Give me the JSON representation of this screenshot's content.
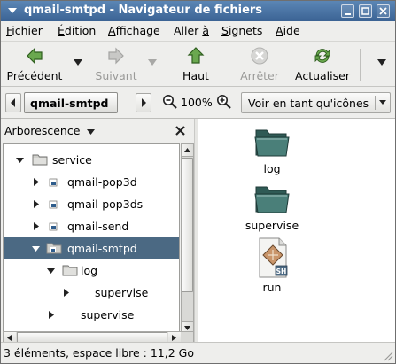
{
  "window": {
    "title": "qmail-smtpd - Navigateur de fichiers"
  },
  "menubar": {
    "items": [
      {
        "hotkey": "F",
        "rest": "ichier"
      },
      {
        "hotkey": "É",
        "rest": "dition"
      },
      {
        "hotkey": "A",
        "rest": "ffichage"
      },
      {
        "prefix": "Aller ",
        "hotkey": "à",
        "rest": ""
      },
      {
        "hotkey": "S",
        "rest": "ignets"
      },
      {
        "hotkey": "A",
        "rest": "ide"
      }
    ]
  },
  "toolbar": {
    "back_label": "Précédent",
    "forward_label": "Suivant",
    "up_label": "Haut",
    "stop_label": "Arrêter",
    "reload_label": "Actualiser"
  },
  "location": {
    "path_button": "qmail-smtpd",
    "zoom_level": "100%",
    "view_mode": "Voir en tant qu'icônes"
  },
  "sidepane": {
    "selector_label": "Arborescence",
    "tree": [
      {
        "label": "service",
        "expanded": true,
        "icon": "folder-icon"
      },
      {
        "label": "qmail-pop3d",
        "expanded": false,
        "icon": "service-folder-icon"
      },
      {
        "label": "qmail-pop3ds",
        "expanded": false,
        "icon": "service-folder-icon"
      },
      {
        "label": "qmail-send",
        "expanded": false,
        "icon": "service-folder-icon"
      },
      {
        "label": "qmail-smtpd",
        "expanded": true,
        "icon": "service-folder-icon",
        "selected": true
      },
      {
        "label": "log",
        "expanded": true,
        "icon": "folder-icon"
      },
      {
        "label": "supervise",
        "expanded": false,
        "icon": "none"
      },
      {
        "label": "supervise",
        "expanded": false,
        "icon": "none"
      }
    ]
  },
  "files": [
    {
      "name": "log",
      "icon": "folder-icon"
    },
    {
      "name": "supervise",
      "icon": "folder-icon"
    },
    {
      "name": "run",
      "icon": "shell-script-icon",
      "badge": "SH"
    }
  ],
  "status": {
    "text": "3 éléments, espace libre : 11,2 Go"
  },
  "colors": {
    "titlebar": "#3b6394",
    "selection": "#4b6983",
    "folder": "#3f6f6a"
  }
}
